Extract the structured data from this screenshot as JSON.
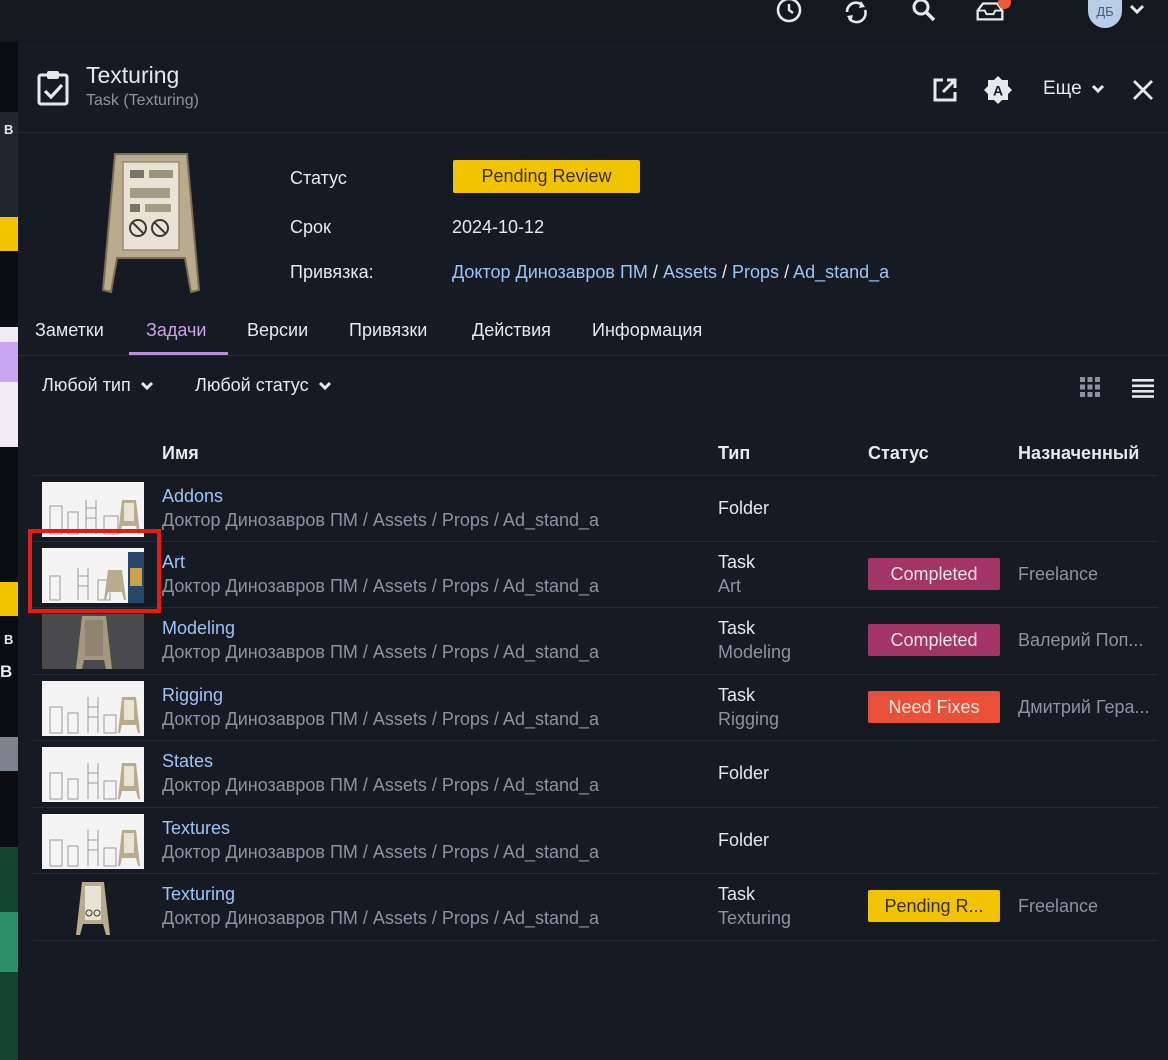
{
  "topbar": {
    "icons": [
      "history-icon",
      "sync-icon",
      "search-icon",
      "inbox-icon"
    ],
    "avatar_initials": "ДБ"
  },
  "header": {
    "title": "Texturing",
    "subtitle": "Task (Texturing)",
    "more_label": "Еще"
  },
  "summary": {
    "status_label": "Статус",
    "status_value": "Pending Review",
    "status_color": "#f2c300",
    "due_label": "Срок",
    "due_value": "2024-10-12",
    "link_label": "Привязка:",
    "link_path": [
      "Доктор Динозавров ПМ",
      "Assets",
      "Props",
      "Ad_stand_a"
    ]
  },
  "tabs": [
    {
      "label": "Заметки"
    },
    {
      "label": "Задачи",
      "active": true
    },
    {
      "label": "Версии"
    },
    {
      "label": "Привязки"
    },
    {
      "label": "Действия"
    },
    {
      "label": "Информация"
    }
  ],
  "filters": {
    "type": "Любой тип",
    "status": "Любой статус"
  },
  "table": {
    "columns": {
      "name": "Имя",
      "type": "Тип",
      "status": "Статус",
      "assignee": "Назначенный"
    },
    "rows": [
      {
        "name": "Addons",
        "path": "Доктор Динозавров ПМ / Assets / Props / Ad_stand_a",
        "type": "Folder",
        "subtype": "",
        "status": "",
        "assignee": ""
      },
      {
        "name": "Art",
        "path": "Доктор Динозавров ПМ / Assets / Props / Ad_stand_a",
        "type": "Task",
        "subtype": "Art",
        "status": "Completed",
        "status_color": "#a23466",
        "assignee": "Freelance"
      },
      {
        "name": "Modeling",
        "path": "Доктор Динозавров ПМ / Assets / Props / Ad_stand_a",
        "type": "Task",
        "subtype": "Modeling",
        "status": "Completed",
        "status_color": "#a23466",
        "assignee": "Валерий Поп..."
      },
      {
        "name": "Rigging",
        "path": "Доктор Динозавров ПМ / Assets / Props / Ad_stand_a",
        "type": "Task",
        "subtype": "Rigging",
        "status": "Need Fixes",
        "status_color": "#e9503a",
        "assignee": "Дмитрий Гера..."
      },
      {
        "name": "States",
        "path": "Доктор Динозавров ПМ / Assets / Props / Ad_stand_a",
        "type": "Folder",
        "subtype": "",
        "status": "",
        "assignee": ""
      },
      {
        "name": "Textures",
        "path": "Доктор Динозавров ПМ / Assets / Props / Ad_stand_a",
        "type": "Folder",
        "subtype": "",
        "status": "",
        "assignee": ""
      },
      {
        "name": "Texturing",
        "path": "Доктор Динозавров ПМ / Assets / Props / Ad_stand_a",
        "type": "Task",
        "subtype": "Texturing",
        "status": "Pending R...",
        "status_color": "#f2c300",
        "assignee": "Freelance"
      }
    ]
  }
}
